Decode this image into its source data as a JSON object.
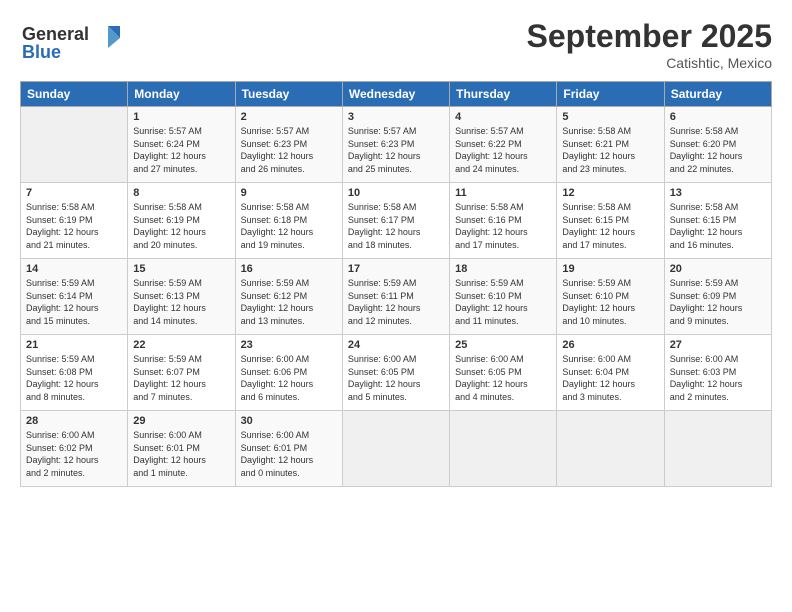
{
  "header": {
    "logo_line1": "General",
    "logo_line2": "Blue",
    "month": "September 2025",
    "location": "Catishtic, Mexico"
  },
  "weekdays": [
    "Sunday",
    "Monday",
    "Tuesday",
    "Wednesday",
    "Thursday",
    "Friday",
    "Saturday"
  ],
  "weeks": [
    [
      {
        "day": "",
        "info": ""
      },
      {
        "day": "1",
        "info": "Sunrise: 5:57 AM\nSunset: 6:24 PM\nDaylight: 12 hours\nand 27 minutes."
      },
      {
        "day": "2",
        "info": "Sunrise: 5:57 AM\nSunset: 6:23 PM\nDaylight: 12 hours\nand 26 minutes."
      },
      {
        "day": "3",
        "info": "Sunrise: 5:57 AM\nSunset: 6:23 PM\nDaylight: 12 hours\nand 25 minutes."
      },
      {
        "day": "4",
        "info": "Sunrise: 5:57 AM\nSunset: 6:22 PM\nDaylight: 12 hours\nand 24 minutes."
      },
      {
        "day": "5",
        "info": "Sunrise: 5:58 AM\nSunset: 6:21 PM\nDaylight: 12 hours\nand 23 minutes."
      },
      {
        "day": "6",
        "info": "Sunrise: 5:58 AM\nSunset: 6:20 PM\nDaylight: 12 hours\nand 22 minutes."
      }
    ],
    [
      {
        "day": "7",
        "info": "Sunrise: 5:58 AM\nSunset: 6:19 PM\nDaylight: 12 hours\nand 21 minutes."
      },
      {
        "day": "8",
        "info": "Sunrise: 5:58 AM\nSunset: 6:19 PM\nDaylight: 12 hours\nand 20 minutes."
      },
      {
        "day": "9",
        "info": "Sunrise: 5:58 AM\nSunset: 6:18 PM\nDaylight: 12 hours\nand 19 minutes."
      },
      {
        "day": "10",
        "info": "Sunrise: 5:58 AM\nSunset: 6:17 PM\nDaylight: 12 hours\nand 18 minutes."
      },
      {
        "day": "11",
        "info": "Sunrise: 5:58 AM\nSunset: 6:16 PM\nDaylight: 12 hours\nand 17 minutes."
      },
      {
        "day": "12",
        "info": "Sunrise: 5:58 AM\nSunset: 6:15 PM\nDaylight: 12 hours\nand 17 minutes."
      },
      {
        "day": "13",
        "info": "Sunrise: 5:58 AM\nSunset: 6:15 PM\nDaylight: 12 hours\nand 16 minutes."
      }
    ],
    [
      {
        "day": "14",
        "info": "Sunrise: 5:59 AM\nSunset: 6:14 PM\nDaylight: 12 hours\nand 15 minutes."
      },
      {
        "day": "15",
        "info": "Sunrise: 5:59 AM\nSunset: 6:13 PM\nDaylight: 12 hours\nand 14 minutes."
      },
      {
        "day": "16",
        "info": "Sunrise: 5:59 AM\nSunset: 6:12 PM\nDaylight: 12 hours\nand 13 minutes."
      },
      {
        "day": "17",
        "info": "Sunrise: 5:59 AM\nSunset: 6:11 PM\nDaylight: 12 hours\nand 12 minutes."
      },
      {
        "day": "18",
        "info": "Sunrise: 5:59 AM\nSunset: 6:10 PM\nDaylight: 12 hours\nand 11 minutes."
      },
      {
        "day": "19",
        "info": "Sunrise: 5:59 AM\nSunset: 6:10 PM\nDaylight: 12 hours\nand 10 minutes."
      },
      {
        "day": "20",
        "info": "Sunrise: 5:59 AM\nSunset: 6:09 PM\nDaylight: 12 hours\nand 9 minutes."
      }
    ],
    [
      {
        "day": "21",
        "info": "Sunrise: 5:59 AM\nSunset: 6:08 PM\nDaylight: 12 hours\nand 8 minutes."
      },
      {
        "day": "22",
        "info": "Sunrise: 5:59 AM\nSunset: 6:07 PM\nDaylight: 12 hours\nand 7 minutes."
      },
      {
        "day": "23",
        "info": "Sunrise: 6:00 AM\nSunset: 6:06 PM\nDaylight: 12 hours\nand 6 minutes."
      },
      {
        "day": "24",
        "info": "Sunrise: 6:00 AM\nSunset: 6:05 PM\nDaylight: 12 hours\nand 5 minutes."
      },
      {
        "day": "25",
        "info": "Sunrise: 6:00 AM\nSunset: 6:05 PM\nDaylight: 12 hours\nand 4 minutes."
      },
      {
        "day": "26",
        "info": "Sunrise: 6:00 AM\nSunset: 6:04 PM\nDaylight: 12 hours\nand 3 minutes."
      },
      {
        "day": "27",
        "info": "Sunrise: 6:00 AM\nSunset: 6:03 PM\nDaylight: 12 hours\nand 2 minutes."
      }
    ],
    [
      {
        "day": "28",
        "info": "Sunrise: 6:00 AM\nSunset: 6:02 PM\nDaylight: 12 hours\nand 2 minutes."
      },
      {
        "day": "29",
        "info": "Sunrise: 6:00 AM\nSunset: 6:01 PM\nDaylight: 12 hours\nand 1 minute."
      },
      {
        "day": "30",
        "info": "Sunrise: 6:00 AM\nSunset: 6:01 PM\nDaylight: 12 hours\nand 0 minutes."
      },
      {
        "day": "",
        "info": ""
      },
      {
        "day": "",
        "info": ""
      },
      {
        "day": "",
        "info": ""
      },
      {
        "day": "",
        "info": ""
      }
    ]
  ]
}
